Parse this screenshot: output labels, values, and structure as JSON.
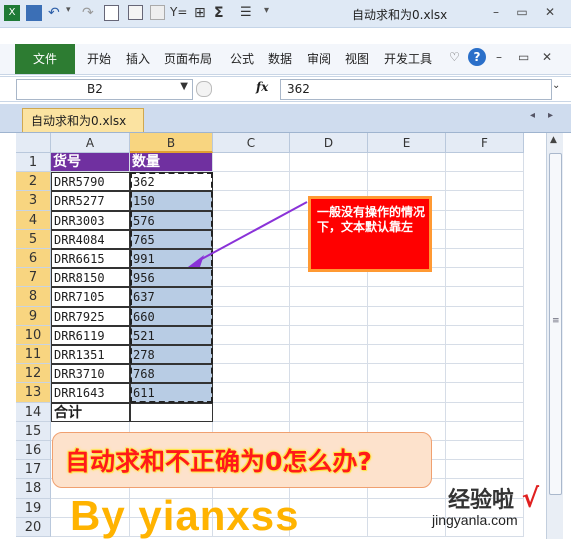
{
  "titlebar": {
    "file_title": "自动求和为0.xlsx",
    "autosum": "Σ",
    "minimize": "–",
    "restore": "▭",
    "close": "✕"
  },
  "ribbon": {
    "tabs": [
      "文件",
      "开始",
      "插入",
      "页面布局",
      "公式",
      "数据",
      "审阅",
      "视图",
      "开发工具"
    ],
    "file_tab_color": "#2d7c32"
  },
  "formula_bar": {
    "name_box": "B2",
    "fx": "fx",
    "value": "362"
  },
  "workbook_tab": {
    "label": "自动求和为0.xlsx"
  },
  "grid": {
    "columns": [
      "A",
      "B",
      "C",
      "D",
      "E",
      "F"
    ],
    "rows": [
      "1",
      "2",
      "3",
      "4",
      "5",
      "6",
      "7",
      "8",
      "9",
      "10",
      "11",
      "12",
      "13",
      "14",
      "15",
      "16",
      "17",
      "18",
      "19",
      "20"
    ],
    "header": {
      "a": "货号",
      "b": "数量"
    },
    "data": [
      {
        "a": "DRR5790",
        "b": "362"
      },
      {
        "a": "DRR5277",
        "b": "150"
      },
      {
        "a": "DRR3003",
        "b": "576"
      },
      {
        "a": "DRR4084",
        "b": "765"
      },
      {
        "a": "DRR6615",
        "b": "991"
      },
      {
        "a": "DRR8150",
        "b": "956"
      },
      {
        "a": "DRR7105",
        "b": "637"
      },
      {
        "a": "DRR7925",
        "b": "660"
      },
      {
        "a": "DRR6119",
        "b": "521"
      },
      {
        "a": "DRR1351",
        "b": "278"
      },
      {
        "a": "DRR3710",
        "b": "768"
      },
      {
        "a": "DRR1643",
        "b": "611"
      }
    ],
    "total_label": "合计",
    "header_fill": "#7030a0",
    "selection_fill": "#b8cce4"
  },
  "annotation": {
    "callout": "一般没有操作的情况下，文本默认靠左",
    "banner": "自动求和不正确为0怎么办?",
    "byline": "By  yianxss",
    "watermark_cn": "经验啦",
    "watermark_check": "√",
    "watermark_url": "jingyanla.com"
  }
}
